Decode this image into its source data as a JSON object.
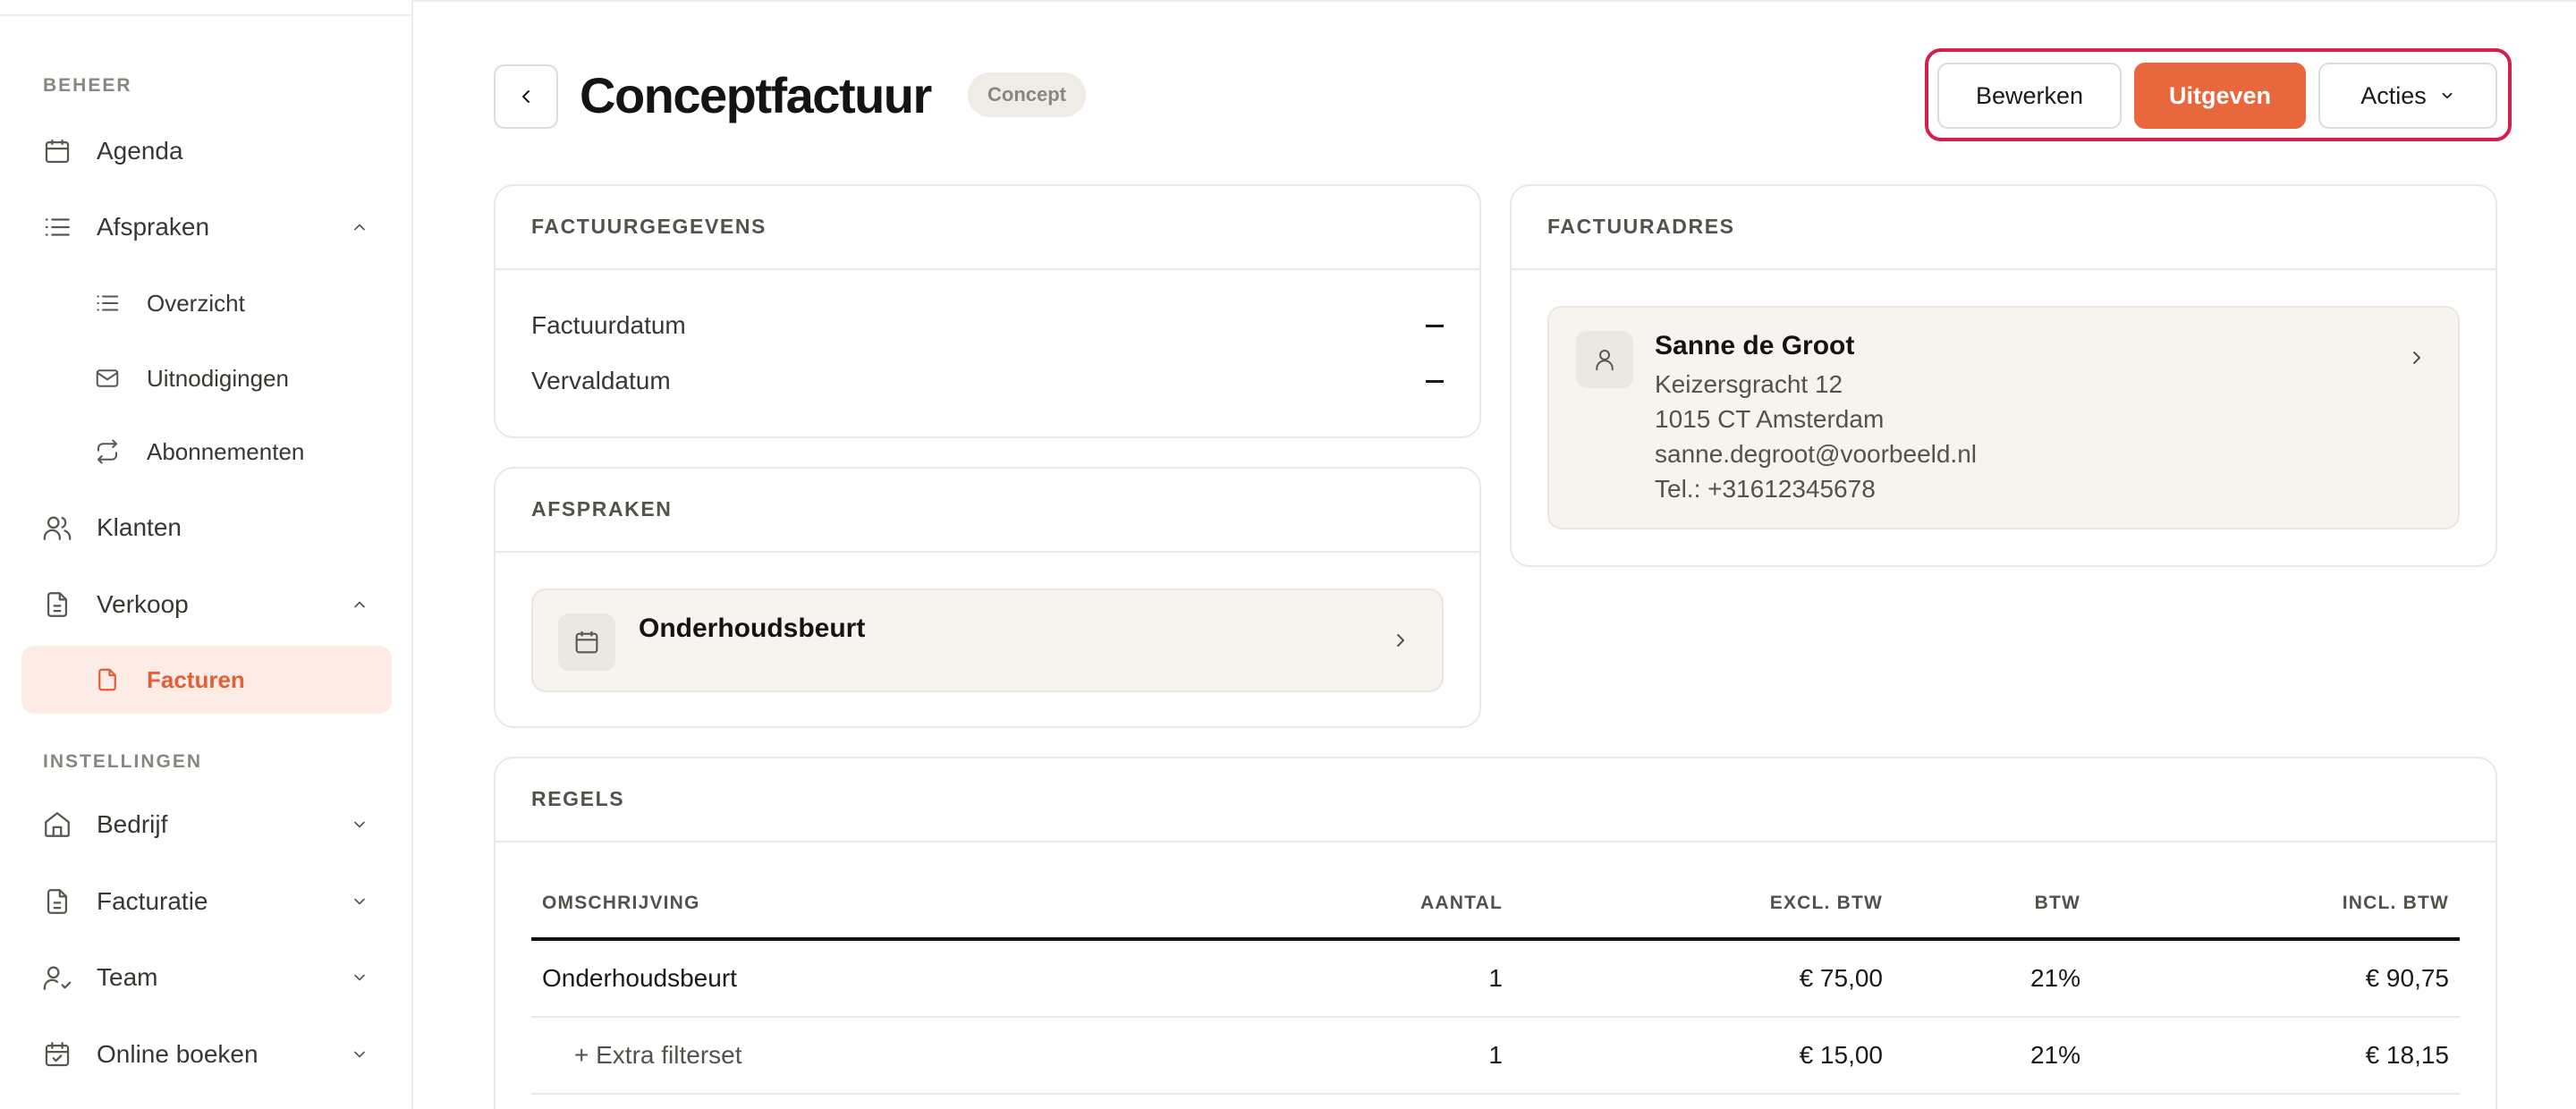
{
  "sidebar": {
    "section_manage": "BEHEER",
    "section_settings": "INSTELLINGEN",
    "items": {
      "agenda": "Agenda",
      "afspraken": "Afspraken",
      "overzicht": "Overzicht",
      "uitnodigingen": "Uitnodigingen",
      "abonnementen": "Abonnementen",
      "klanten": "Klanten",
      "verkoop": "Verkoop",
      "facturen": "Facturen",
      "bedrijf": "Bedrijf",
      "facturatie": "Facturatie",
      "team": "Team",
      "online_boeken": "Online boeken"
    },
    "active_item": "facturen"
  },
  "header": {
    "title": "Conceptfactuur",
    "status": "Concept",
    "edit_label": "Bewerken",
    "publish_label": "Uitgeven",
    "actions_label": "Acties"
  },
  "invoice_details": {
    "title": "FACTUURGEGEVENS",
    "rows": [
      {
        "label": "Factuurdatum",
        "value": "—"
      },
      {
        "label": "Vervaldatum",
        "value": "—"
      }
    ]
  },
  "appointments": {
    "title": "AFSPRAKEN",
    "items": [
      {
        "name": "Onderhoudsbeurt"
      }
    ]
  },
  "billing_address": {
    "title": "FACTUURADRES",
    "name": "Sanne de Groot",
    "street": "Keizersgracht 12",
    "city": "1015 CT Amsterdam",
    "email": "sanne.degroot@voorbeeld.nl",
    "phone": "Tel.: +31612345678"
  },
  "lines": {
    "title": "REGELS",
    "columns": {
      "description": "OMSCHRIJVING",
      "quantity": "AANTAL",
      "excl": "EXCL. BTW",
      "vat": "BTW",
      "incl": "INCL. BTW"
    },
    "rows": [
      {
        "description": "Onderhoudsbeurt",
        "quantity": "1",
        "excl": "€ 75,00",
        "vat": "21%",
        "incl": "€ 90,75"
      },
      {
        "description": "+ Extra filterset",
        "quantity": "1",
        "excl": "€ 15,00",
        "vat": "21%",
        "incl": "€ 18,15"
      }
    ]
  },
  "colors": {
    "accent": "#e8673d",
    "active_bg": "#fdece6",
    "highlight_border": "#d51f4b"
  }
}
